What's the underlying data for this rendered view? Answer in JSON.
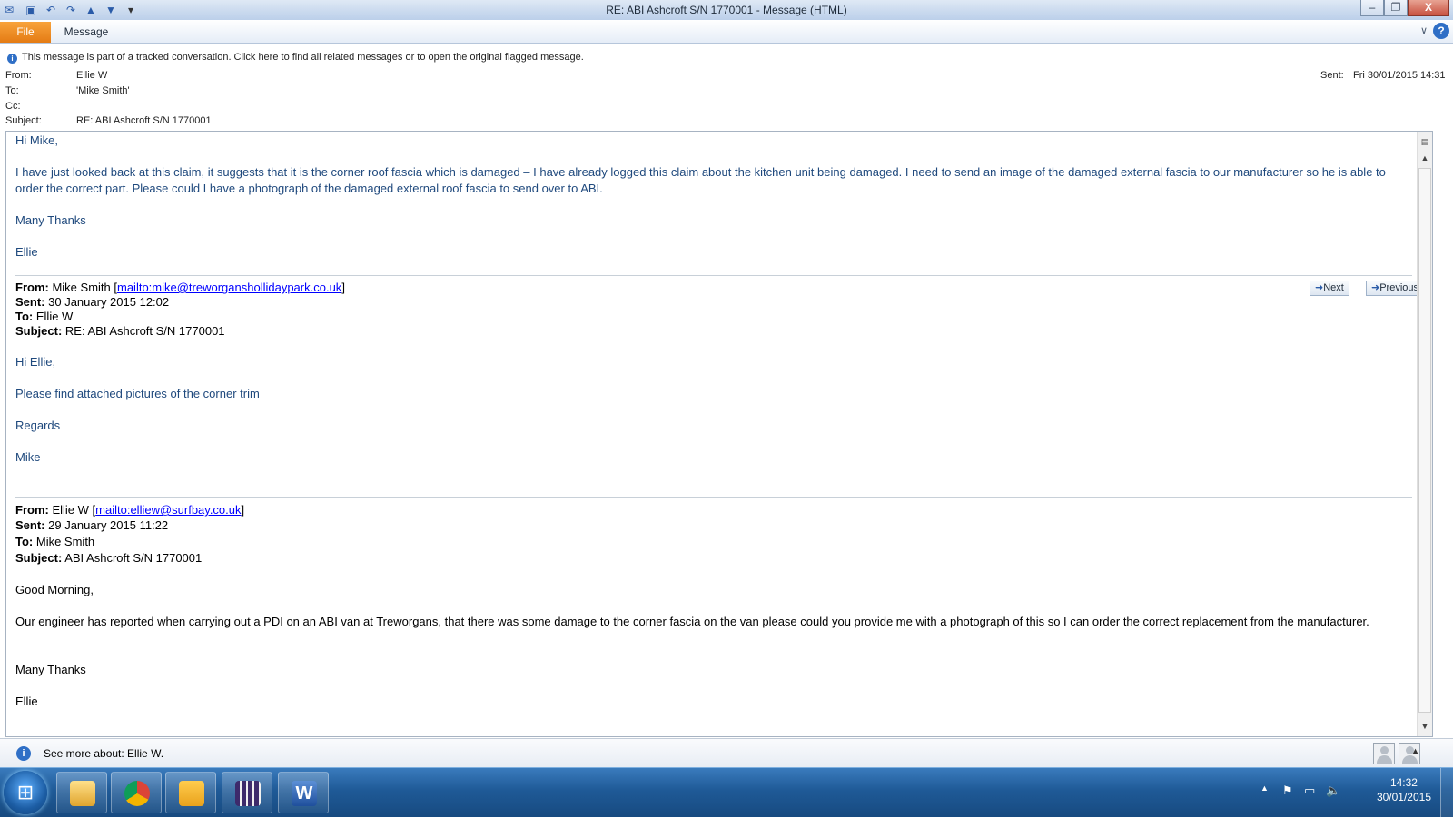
{
  "window": {
    "title": "RE: ABI Ashcroft S/N 1770001  -  Message (HTML)",
    "minimize": "–",
    "restore": "❐",
    "close": "X"
  },
  "ribbon": {
    "file_tab": "File",
    "message_tab": "Message",
    "collapse": "∨",
    "help": "?"
  },
  "header": {
    "info": "This message is part of a tracked conversation. Click here to find all related messages or to open the original flagged message.",
    "from_label": "From:",
    "from": "Ellie W",
    "to_label": "To:",
    "to": "'Mike Smith'",
    "cc_label": "Cc:",
    "cc": "",
    "subject_label": "Subject:",
    "subject": "RE: ABI Ashcroft S/N 1770001",
    "sent_label": "Sent:",
    "sent": "Fri 30/01/2015 14:31"
  },
  "message": {
    "greeting": "Hi Mike,",
    "body": "I have just looked back at this claim, it suggests that it is the corner roof fascia which is damaged – I have already logged this claim about the kitchen unit being damaged. I need to send an image of the damaged external fascia to our manufacturer so he is able to order the correct part. Please could I have a photograph of the damaged external roof fascia to send over to ABI.",
    "thanks": "Many Thanks",
    "sign": "Ellie"
  },
  "reply1": {
    "from_label": "From:",
    "from_name": "Mike Smith",
    "from_link": "mailto:mike@treworganshollidaypark.co.uk",
    "sent_label": "Sent:",
    "sent": "30 January 2015 12:02",
    "to_label": "To:",
    "to": "Ellie W",
    "subject_label": "Subject:",
    "subject": "RE: ABI Ashcroft S/N 1770001",
    "greeting": "Hi Ellie,",
    "body": "Please find attached pictures of the corner trim",
    "regards": "Regards",
    "sign": "Mike",
    "next": "Next",
    "previous": "Previous"
  },
  "reply2": {
    "from_label": "From:",
    "from_name": "Ellie W",
    "from_link": "mailto:elliew@surfbay.co.uk",
    "sent_label": "Sent:",
    "sent": "29 January 2015 11:22",
    "to_label": "To:",
    "to": "Mike Smith",
    "subject_label": "Subject:",
    "subject": "ABI Ashcroft S/N 1770001",
    "greeting": "Good Morning,",
    "body": "Our engineer has reported when carrying out a PDI on an ABI van at Treworgans, that there was some damage to the corner fascia on the van please could you provide me with a photograph of this so I can order the correct replacement from the manufacturer.",
    "thanks": "Many Thanks",
    "sign": "Ellie"
  },
  "people_pane": {
    "text": "See more about: Ellie W."
  },
  "taskbar": {
    "time": "14:32",
    "date": "30/01/2015",
    "apps": [
      "windows-explorer",
      "google-chrome",
      "microsoft-outlook",
      "calendar-app",
      "microsoft-word"
    ]
  }
}
